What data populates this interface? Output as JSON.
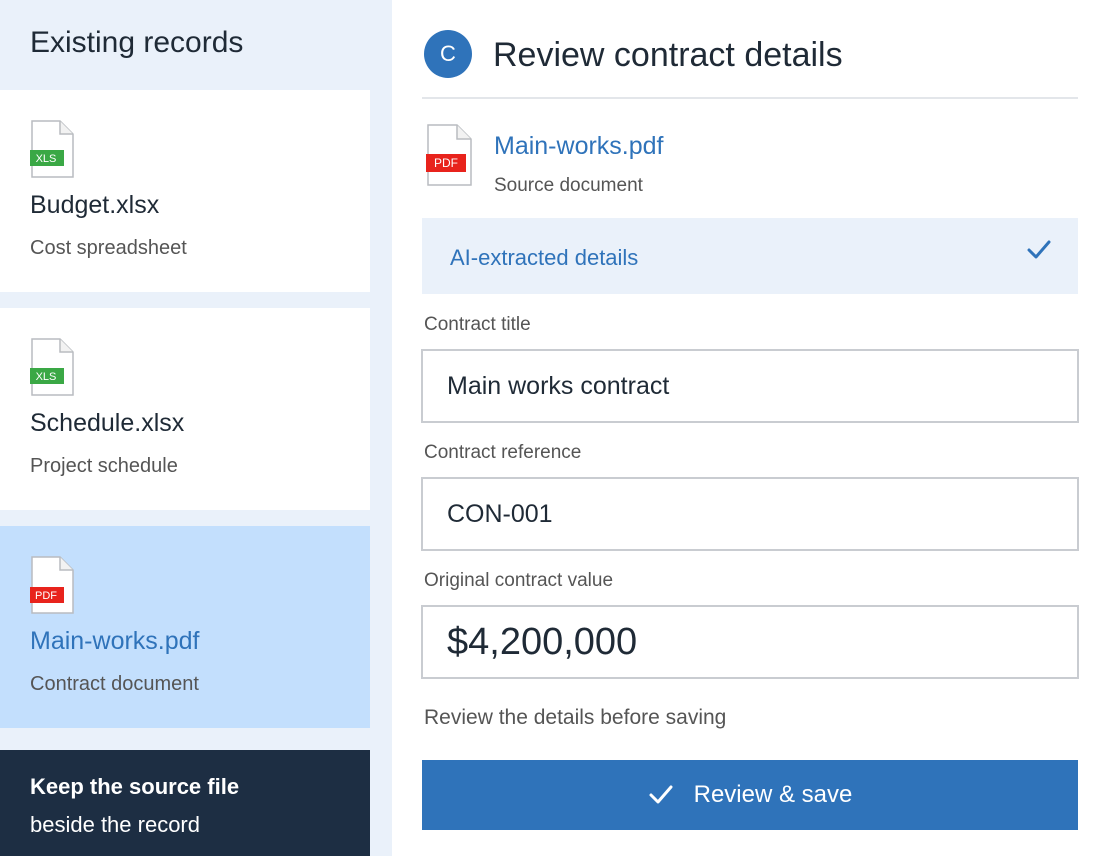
{
  "sidebar": {
    "title": "Existing records",
    "items": [
      {
        "name": "Budget.xlsx",
        "subtitle": "Cost spreadsheet",
        "badge": "XLS",
        "icon": "xls-file-icon"
      },
      {
        "name": "Schedule.xlsx",
        "subtitle": "Project schedule",
        "badge": "XLS",
        "icon": "xls-file-icon"
      },
      {
        "name": "Main-works.pdf",
        "subtitle": "Contract document",
        "badge": "PDF",
        "icon": "pdf-file-icon",
        "selected": true
      }
    ],
    "tip": {
      "line1": "Keep the source file",
      "line2": "beside the record"
    }
  },
  "main": {
    "avatar_letter": "C",
    "title": "Review contract details",
    "document": {
      "name": "Main-works.pdf",
      "subtitle": "Source document",
      "badge": "PDF"
    },
    "ai_section": {
      "label": "AI-extracted details",
      "status_icon": "checkmark-icon"
    },
    "fields": [
      {
        "label": "Contract title",
        "value": "Main works contract"
      },
      {
        "label": "Contract reference",
        "value": "CON-001"
      },
      {
        "label": "Original contract value",
        "value": "$4,200,000"
      }
    ],
    "hint": "Review the details before saving",
    "save_button": {
      "label": "Review & save",
      "icon": "checkmark-icon"
    }
  },
  "colors": {
    "accent": "#2f73ba",
    "sidebar_bg": "#eaf1fa",
    "selected_bg": "#c3dffd",
    "tip_bg": "#1d2e43",
    "xls_badge": "#3aa845",
    "pdf_badge": "#e8231c"
  }
}
